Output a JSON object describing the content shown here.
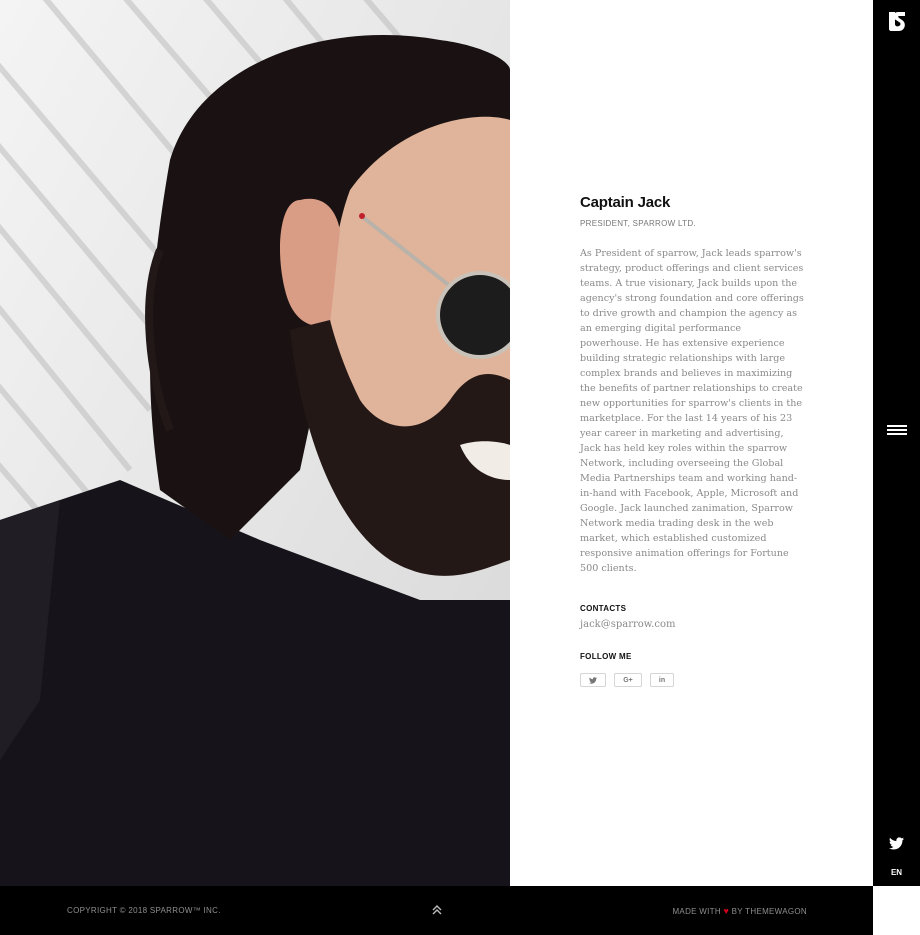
{
  "profile": {
    "name": "Captain Jack",
    "role": "PRESIDENT, SPARROW LTD.",
    "bio": "As President of sparrow, Jack leads sparrow's strategy, product offerings and client services teams. A true visionary, Jack builds upon the agency's strong foundation and core offerings to drive growth and champion the agency as an emerging digital performance powerhouse. He has extensive experience building strategic relationships with large complex brands and believes in maximizing the benefits of partner relationships to create new opportunities for sparrow's clients in the marketplace. For the last 14 years of his 23 year career in marketing and advertising, Jack has held key roles within the sparrow Network, including overseeing the Global Media Partnerships team and working hand-in-hand with Facebook, Apple, Microsoft and Google. Jack launched zanimation, Sparrow Network media trading desk in the web market, which established customized responsive animation offerings for Fortune 500 clients."
  },
  "contacts": {
    "label": "CONTACTS",
    "email": "jack@sparrow.com"
  },
  "follow": {
    "label": "FOLLOW ME",
    "buttons": [
      {
        "label": "✦",
        "icon": "twitter-icon"
      },
      {
        "label": "G+",
        "icon": "google-plus-icon"
      },
      {
        "label": "in",
        "icon": "linkedin-icon"
      }
    ]
  },
  "sidebar": {
    "logo_icon": "sparrow-logo-icon",
    "menu_icon": "hamburger-menu-icon",
    "twitter_icon": "twitter-icon",
    "language": "EN"
  },
  "footer": {
    "copyright": "COPYRIGHT © 2018 SPARROW™ INC.",
    "made_prefix": "MADE WITH",
    "heart": "♥",
    "made_suffix": "BY THEMEWAGON",
    "up_icon": "double-chevron-up-icon"
  },
  "colors": {
    "sidebar": "#000000",
    "footer": "#000000",
    "heart": "#d0021b",
    "body_text": "#8a8a8a"
  }
}
